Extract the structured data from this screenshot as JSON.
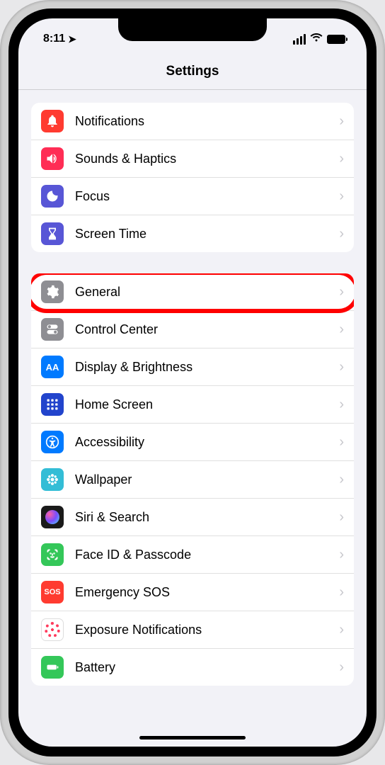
{
  "statusBar": {
    "time": "8:11",
    "locationActive": true
  },
  "header": {
    "title": "Settings"
  },
  "groups": [
    {
      "rows": [
        {
          "id": "notifications",
          "label": "Notifications",
          "iconColor": "#ff3b30",
          "iconName": "bell-icon"
        },
        {
          "id": "sounds",
          "label": "Sounds & Haptics",
          "iconColor": "#ff2d55",
          "iconName": "speaker-icon"
        },
        {
          "id": "focus",
          "label": "Focus",
          "iconColor": "#5856d6",
          "iconName": "moon-icon"
        },
        {
          "id": "screentime",
          "label": "Screen Time",
          "iconColor": "#5856d6",
          "iconName": "hourglass-icon"
        }
      ]
    },
    {
      "rows": [
        {
          "id": "general",
          "label": "General",
          "iconColor": "#8e8e93",
          "iconName": "gear-icon",
          "highlighted": true
        },
        {
          "id": "controlcenter",
          "label": "Control Center",
          "iconColor": "#8e8e93",
          "iconName": "toggles-icon"
        },
        {
          "id": "display",
          "label": "Display & Brightness",
          "iconColor": "#007aff",
          "iconName": "text-size-icon"
        },
        {
          "id": "homescreen",
          "label": "Home Screen",
          "iconColor": "#3355dd",
          "iconName": "grid-icon"
        },
        {
          "id": "accessibility",
          "label": "Accessibility",
          "iconColor": "#007aff",
          "iconName": "accessibility-icon"
        },
        {
          "id": "wallpaper",
          "label": "Wallpaper",
          "iconColor": "#33bdd6",
          "iconName": "flower-icon"
        },
        {
          "id": "siri",
          "label": "Siri & Search",
          "iconColor": "#1a1a1a",
          "iconName": "siri-icon"
        },
        {
          "id": "faceid",
          "label": "Face ID & Passcode",
          "iconColor": "#34c759",
          "iconName": "faceid-icon"
        },
        {
          "id": "sos",
          "label": "Emergency SOS",
          "iconColor": "#ff3b30",
          "iconName": "sos-icon",
          "iconText": "SOS"
        },
        {
          "id": "exposure",
          "label": "Exposure Notifications",
          "iconColor": "#ffffff",
          "iconName": "exposure-icon"
        },
        {
          "id": "battery",
          "label": "Battery",
          "iconColor": "#34c759",
          "iconName": "battery-icon"
        }
      ]
    }
  ]
}
